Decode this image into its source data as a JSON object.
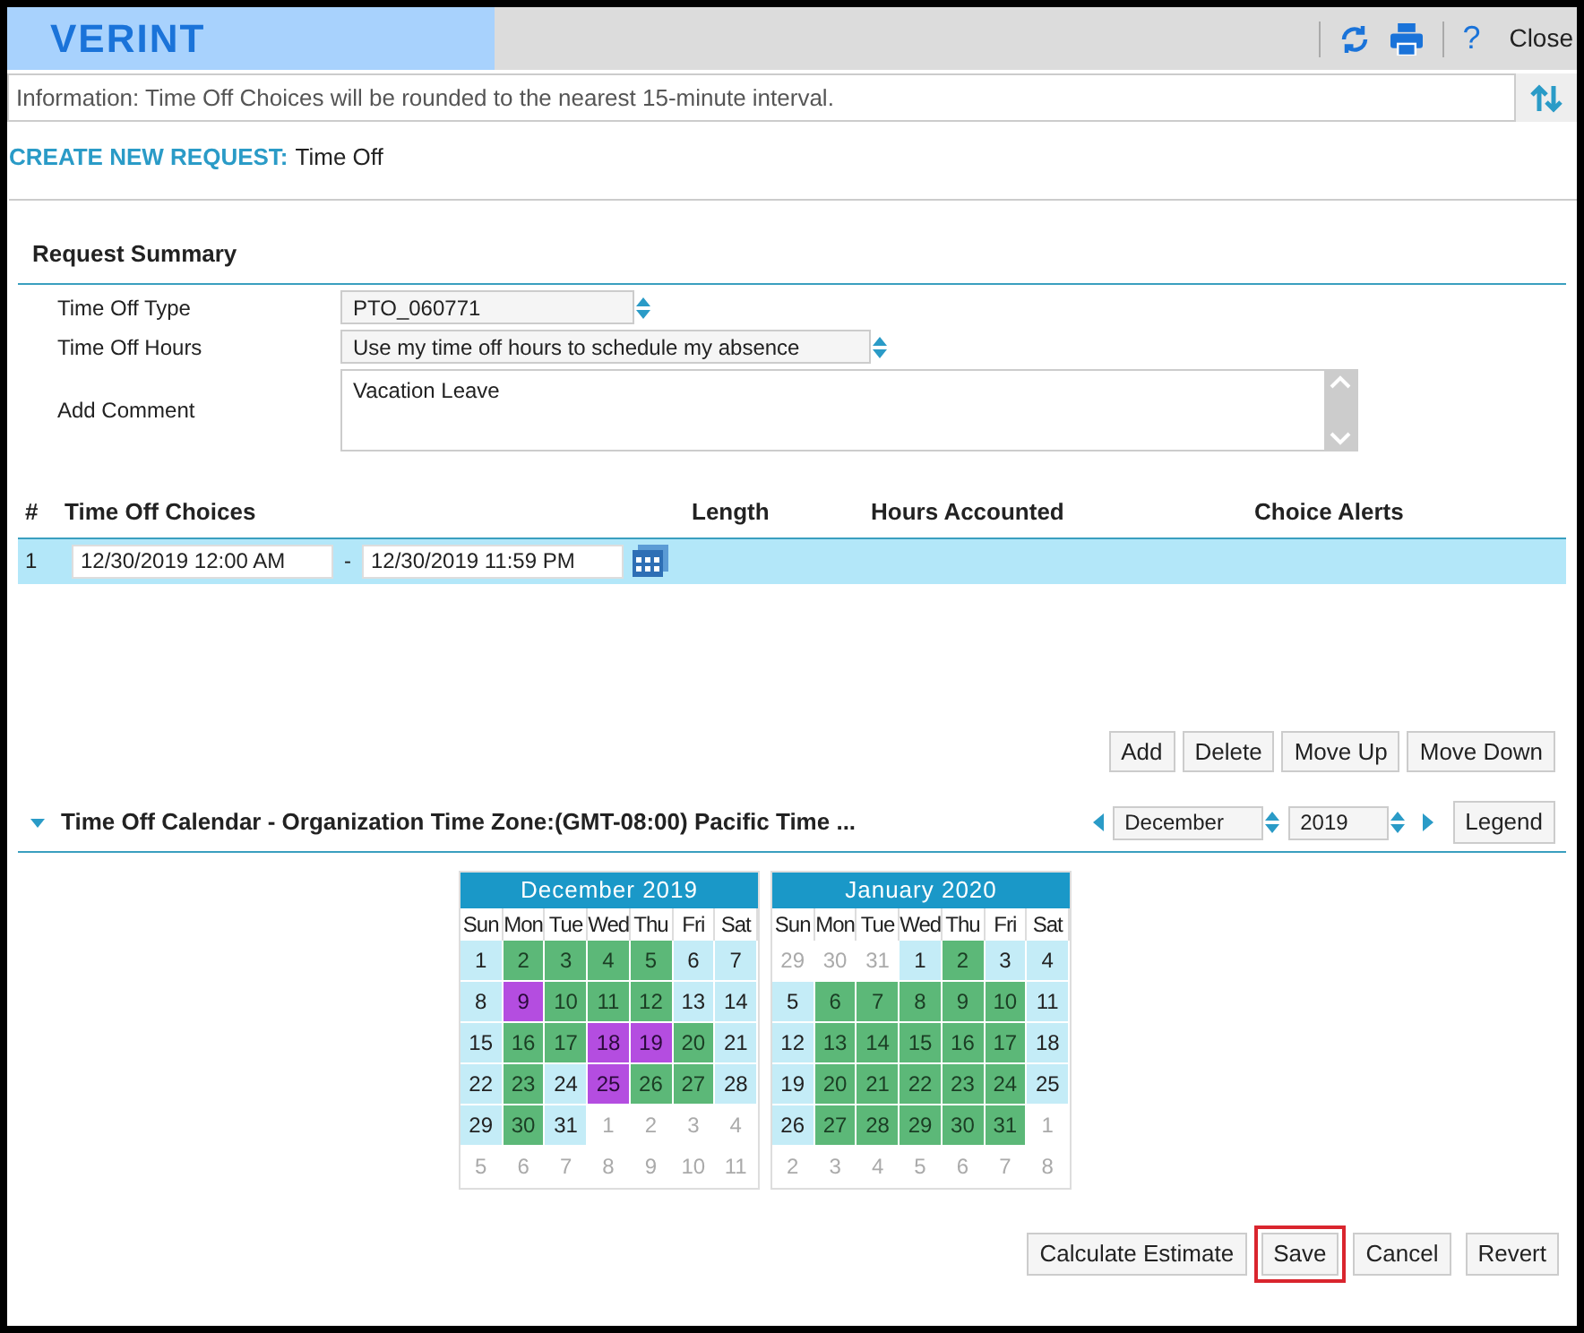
{
  "header": {
    "logo": "VERINT",
    "help": "?",
    "close": "Close"
  },
  "info": "Information: Time Off Choices will be rounded to the nearest 15-minute interval.",
  "page_title": {
    "label": "CREATE NEW REQUEST:",
    "value": "Time Off"
  },
  "summary": {
    "title": "Request Summary",
    "fields": [
      {
        "kind": "select",
        "label": "Time Off Type",
        "value": "PTO_060771"
      },
      {
        "kind": "select",
        "label": "Time Off Hours",
        "value": "Use my time off hours to schedule my absence"
      },
      {
        "kind": "textarea",
        "label": "Add Comment",
        "value": "Vacation Leave"
      }
    ]
  },
  "choices": {
    "columns": [
      "#",
      "Time Off Choices",
      "Length",
      "Hours Accounted",
      "Choice Alerts"
    ],
    "rows": [
      {
        "index": "1",
        "start": "12/30/2019 12:00 AM",
        "separator": "-",
        "end": "12/30/2019 11:59 PM",
        "selected": true
      }
    ],
    "buttons": [
      "Add",
      "Delete",
      "Move Up",
      "Move Down"
    ]
  },
  "calendar": {
    "title": "Time Off Calendar - Organization Time Zone:(GMT-08:00) Pacific Time ...",
    "expanded": true,
    "month": "December",
    "year": "2019",
    "legend": "Legend",
    "months": [
      {
        "title": "December 2019",
        "weekdays": [
          "Sun",
          "Mon",
          "Tue",
          "Wed",
          "Thu",
          "Fri",
          "Sat"
        ],
        "weeks": [
          [
            {
              "d": "1",
              "kind": "off"
            },
            {
              "d": "2",
              "kind": "work"
            },
            {
              "d": "3",
              "kind": "work"
            },
            {
              "d": "4",
              "kind": "work"
            },
            {
              "d": "5",
              "kind": "work"
            },
            {
              "d": "6",
              "kind": "off"
            },
            {
              "d": "7",
              "kind": "off"
            }
          ],
          [
            {
              "d": "8",
              "kind": "off"
            },
            {
              "d": "9",
              "kind": "pto"
            },
            {
              "d": "10",
              "kind": "work"
            },
            {
              "d": "11",
              "kind": "work"
            },
            {
              "d": "12",
              "kind": "work"
            },
            {
              "d": "13",
              "kind": "off"
            },
            {
              "d": "14",
              "kind": "off"
            }
          ],
          [
            {
              "d": "15",
              "kind": "off"
            },
            {
              "d": "16",
              "kind": "work"
            },
            {
              "d": "17",
              "kind": "work"
            },
            {
              "d": "18",
              "kind": "pto"
            },
            {
              "d": "19",
              "kind": "pto"
            },
            {
              "d": "20",
              "kind": "work"
            },
            {
              "d": "21",
              "kind": "off"
            }
          ],
          [
            {
              "d": "22",
              "kind": "off"
            },
            {
              "d": "23",
              "kind": "work"
            },
            {
              "d": "24",
              "kind": "off"
            },
            {
              "d": "25",
              "kind": "pto"
            },
            {
              "d": "26",
              "kind": "work"
            },
            {
              "d": "27",
              "kind": "work"
            },
            {
              "d": "28",
              "kind": "off"
            }
          ],
          [
            {
              "d": "29",
              "kind": "off"
            },
            {
              "d": "30",
              "kind": "work"
            },
            {
              "d": "31",
              "kind": "off"
            },
            {
              "d": "1",
              "kind": "other"
            },
            {
              "d": "2",
              "kind": "other"
            },
            {
              "d": "3",
              "kind": "other"
            },
            {
              "d": "4",
              "kind": "other"
            }
          ],
          [
            {
              "d": "5",
              "kind": "other"
            },
            {
              "d": "6",
              "kind": "other"
            },
            {
              "d": "7",
              "kind": "other"
            },
            {
              "d": "8",
              "kind": "other"
            },
            {
              "d": "9",
              "kind": "other"
            },
            {
              "d": "10",
              "kind": "other"
            },
            {
              "d": "11",
              "kind": "other"
            }
          ]
        ]
      },
      {
        "title": "January 2020",
        "weekdays": [
          "Sun",
          "Mon",
          "Tue",
          "Wed",
          "Thu",
          "Fri",
          "Sat"
        ],
        "weeks": [
          [
            {
              "d": "29",
              "kind": "other"
            },
            {
              "d": "30",
              "kind": "other"
            },
            {
              "d": "31",
              "kind": "other"
            },
            {
              "d": "1",
              "kind": "off"
            },
            {
              "d": "2",
              "kind": "work"
            },
            {
              "d": "3",
              "kind": "off"
            },
            {
              "d": "4",
              "kind": "off"
            }
          ],
          [
            {
              "d": "5",
              "kind": "off"
            },
            {
              "d": "6",
              "kind": "work"
            },
            {
              "d": "7",
              "kind": "work"
            },
            {
              "d": "8",
              "kind": "work"
            },
            {
              "d": "9",
              "kind": "work"
            },
            {
              "d": "10",
              "kind": "work"
            },
            {
              "d": "11",
              "kind": "off"
            }
          ],
          [
            {
              "d": "12",
              "kind": "off"
            },
            {
              "d": "13",
              "kind": "work"
            },
            {
              "d": "14",
              "kind": "work"
            },
            {
              "d": "15",
              "kind": "work"
            },
            {
              "d": "16",
              "kind": "work"
            },
            {
              "d": "17",
              "kind": "work"
            },
            {
              "d": "18",
              "kind": "off"
            }
          ],
          [
            {
              "d": "19",
              "kind": "off"
            },
            {
              "d": "20",
              "kind": "work"
            },
            {
              "d": "21",
              "kind": "work"
            },
            {
              "d": "22",
              "kind": "work"
            },
            {
              "d": "23",
              "kind": "work"
            },
            {
              "d": "24",
              "kind": "work"
            },
            {
              "d": "25",
              "kind": "off"
            }
          ],
          [
            {
              "d": "26",
              "kind": "off"
            },
            {
              "d": "27",
              "kind": "work"
            },
            {
              "d": "28",
              "kind": "work"
            },
            {
              "d": "29",
              "kind": "work"
            },
            {
              "d": "30",
              "kind": "work"
            },
            {
              "d": "31",
              "kind": "work"
            },
            {
              "d": "1",
              "kind": "other"
            }
          ],
          [
            {
              "d": "2",
              "kind": "other"
            },
            {
              "d": "3",
              "kind": "other"
            },
            {
              "d": "4",
              "kind": "other"
            },
            {
              "d": "5",
              "kind": "other"
            },
            {
              "d": "6",
              "kind": "other"
            },
            {
              "d": "7",
              "kind": "other"
            },
            {
              "d": "8",
              "kind": "other"
            }
          ]
        ]
      }
    ]
  },
  "footer_buttons": [
    {
      "label": "Calculate Estimate",
      "highlighted": false
    },
    {
      "label": "Save",
      "highlighted": true
    },
    {
      "label": "Cancel",
      "highlighted": false
    },
    {
      "label": "Revert",
      "highlighted": false
    }
  ]
}
